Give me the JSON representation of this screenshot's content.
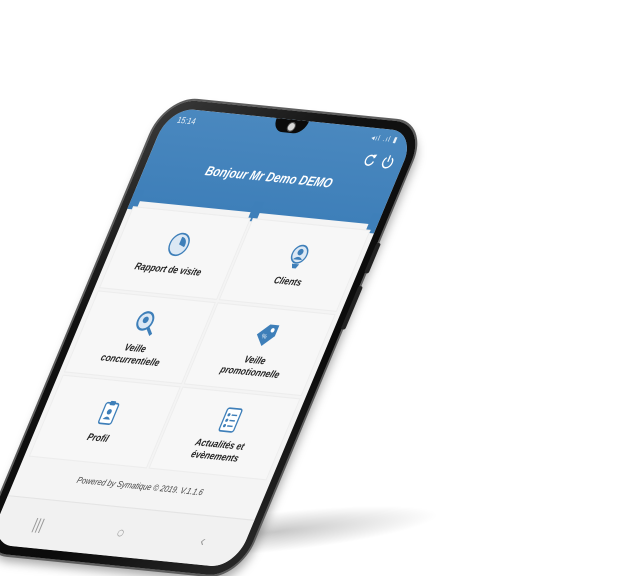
{
  "status_bar": {
    "time": "15:14",
    "icons": "◂ıl .ıl ▮"
  },
  "header": {
    "greeting": "Bonjour Mr Demo DEMO",
    "refresh_icon": "refresh-icon",
    "power_icon": "power-icon",
    "color": "#3e7fb9"
  },
  "menu": {
    "items": [
      {
        "label": "Rapport de visite",
        "icon": "report-icon"
      },
      {
        "label": "Clients",
        "icon": "client-icon"
      },
      {
        "label": "Veille concurrentielle",
        "icon": "search-icon"
      },
      {
        "label": "Veille promotionnelle",
        "icon": "tag-icon"
      },
      {
        "label": "Profil",
        "icon": "profile-icon"
      },
      {
        "label": "Actualités et évènements",
        "icon": "checklist-icon"
      }
    ]
  },
  "footer": {
    "powered_by": "Powered by Symatique © 2019. V.1.1.6"
  },
  "navigation": {
    "recent": "|||",
    "home": "○",
    "back": "‹"
  }
}
